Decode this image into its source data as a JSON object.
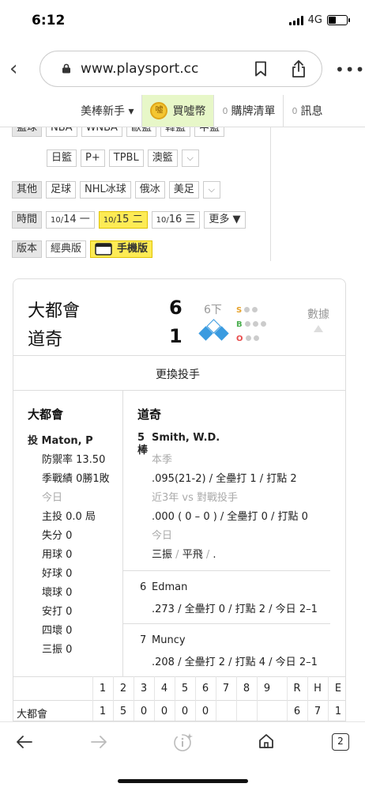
{
  "status_bar": {
    "time": "6:12",
    "network": "4G"
  },
  "browser": {
    "url": "www.playsport.cc",
    "tab_count": "2"
  },
  "site_nav": {
    "items": [
      {
        "label": "美棒新手 ▾"
      },
      {
        "label": "買噓幣",
        "coin_glyph": "噓"
      },
      {
        "count": "0",
        "label": "購牌清單"
      },
      {
        "count": "0",
        "label": "訊息"
      }
    ]
  },
  "filters": {
    "basketball_label": "籃球",
    "basketball_row1": [
      "NBA",
      "WNBA",
      "歐籃",
      "韓籃",
      "中籃"
    ],
    "basketball_row2": [
      "日籃",
      "P+",
      "TPBL",
      "澳籃"
    ],
    "other_label": "其他",
    "other_items": [
      "足球",
      "NHL冰球",
      "俄冰",
      "美足"
    ],
    "time_label": "時間",
    "dates": [
      {
        "small": "10/",
        "day": "14",
        "weekday": "一"
      },
      {
        "small": "10/",
        "day": "15",
        "weekday": "二"
      },
      {
        "small": "10/",
        "day": "16",
        "weekday": "三"
      }
    ],
    "more_label": "更多 ▼",
    "version_label": "版本",
    "classic_label": "經典版",
    "mobile_label": "手機版",
    "dropdown_glyph": "⌵"
  },
  "game": {
    "away_team": "大都會",
    "home_team": "道奇",
    "away_score": "6",
    "home_score": "1",
    "inning": "6下",
    "sbo": {
      "s": "S",
      "b": "B",
      "o": "O"
    },
    "stats_link": "數據",
    "change_pitcher": "更換投手",
    "colors": {
      "strike": "#e7a32b",
      "ball": "#4caf50",
      "out": "#e84c4c",
      "base": "#3a9be0"
    }
  },
  "pitcher_panel": {
    "team": "大都會",
    "role": "投",
    "name": "Maton, P",
    "lines": [
      "防禦率 13.50",
      "季戰績 0勝1敗"
    ],
    "today_label": "今日",
    "today_lines": [
      "主投 0.0 局",
      "失分 0",
      "用球 0",
      "好球 0",
      "壞球 0",
      "安打 0",
      "四壞 0",
      "三振 0"
    ]
  },
  "batter_panel": {
    "team": "道奇",
    "current": {
      "order": "5",
      "order_suffix": "棒",
      "name": "Smith, W.D.",
      "season_label": "本季",
      "season_line": ".095(21-2) / 全壘打 1 / 打點 2",
      "vs_label": "近3年 vs 對戰投手",
      "vs_line": ".000 ( 0 – 0 ) / 全壘打 0 / 打點 0",
      "today_label": "今日",
      "today_a": "三振",
      "today_b": "平飛",
      "today_c": "."
    },
    "next": [
      {
        "order": "6",
        "name": "Edman",
        "line": ".273 / 全壘打 0 / 打點 2 / 今日 2–1"
      },
      {
        "order": "7",
        "name": "Muncy",
        "line": ".208 / 全壘打 2 / 打點 4 / 今日 2–1"
      }
    ]
  },
  "scoreboard": {
    "innings": [
      "1",
      "2",
      "3",
      "4",
      "5",
      "6",
      "7",
      "8",
      "9"
    ],
    "totals": [
      "R",
      "H",
      "E"
    ],
    "away": {
      "team": "大都會",
      "runs": [
        "1",
        "5",
        "0",
        "0",
        "0",
        "0",
        "",
        "",
        ""
      ],
      "totals": [
        "6",
        "7",
        "1"
      ]
    }
  }
}
